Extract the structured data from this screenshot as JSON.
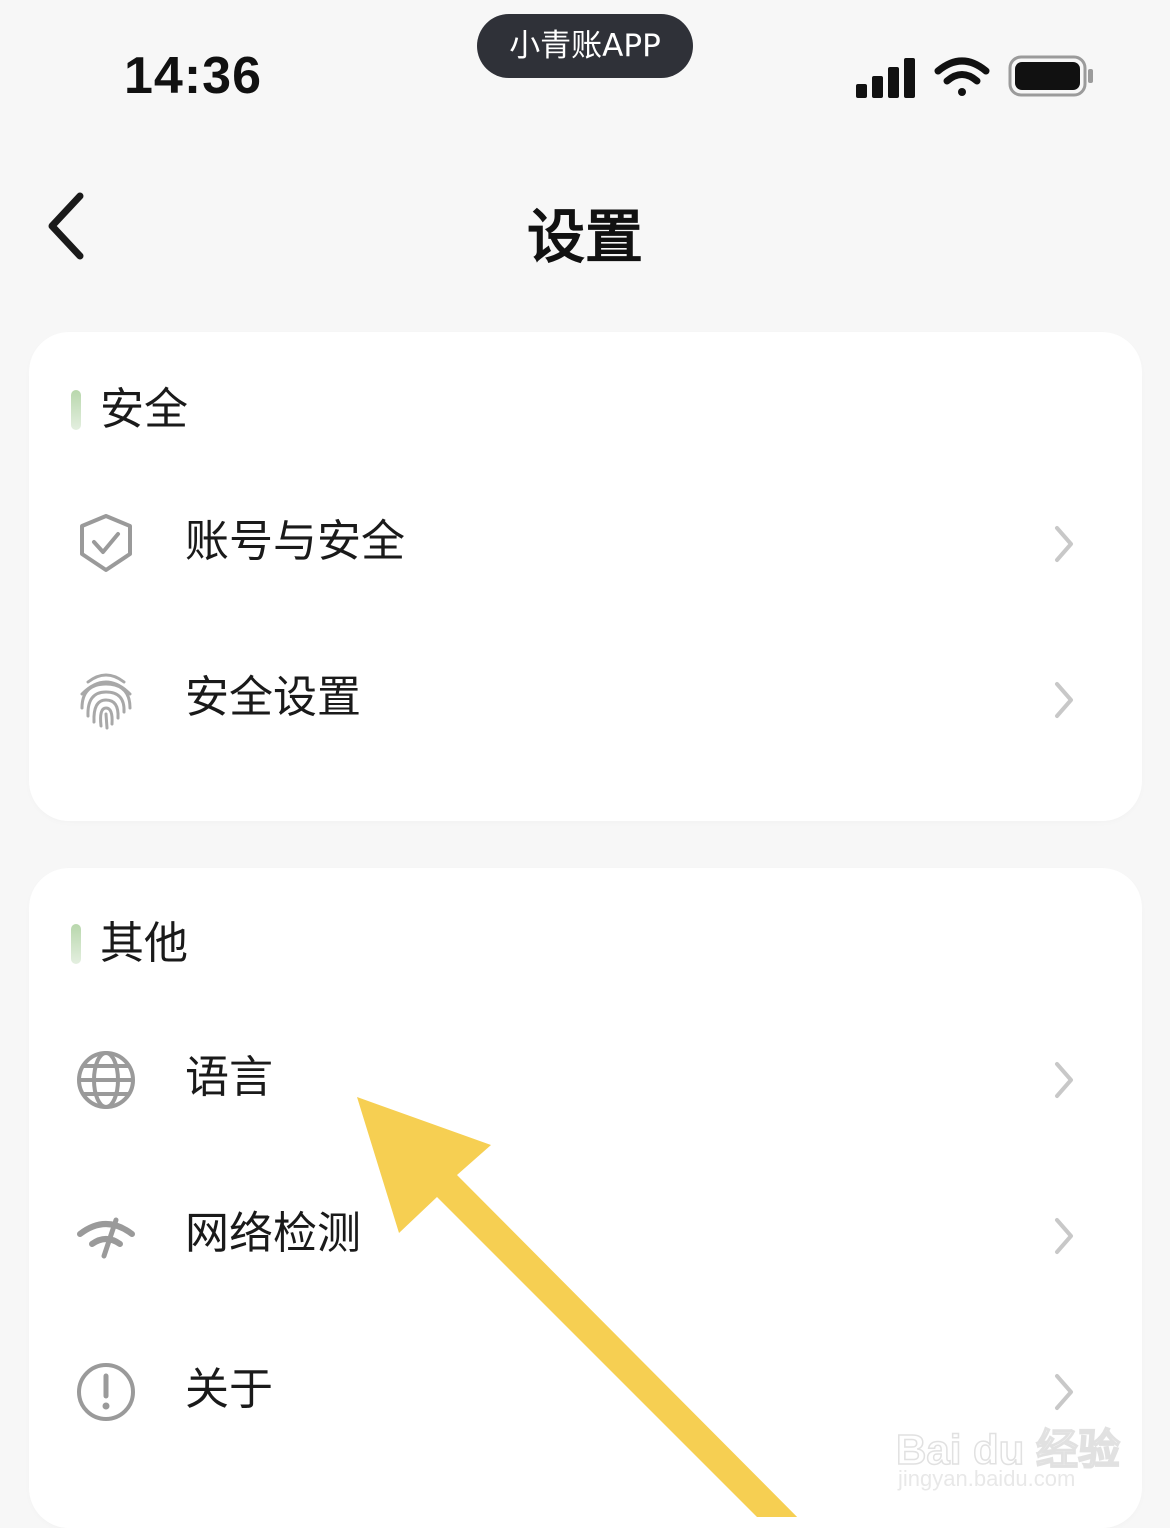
{
  "status_bar": {
    "time": "14:36",
    "app_name": "小青账APP",
    "icons": [
      "signal-icon",
      "wifi-icon",
      "battery-icon"
    ]
  },
  "nav": {
    "title": "设置",
    "back_icon": "back-chevron-icon"
  },
  "sections": [
    {
      "title": "安全",
      "items": [
        {
          "label": "账号与安全",
          "icon": "shield-check-icon"
        },
        {
          "label": "安全设置",
          "icon": "fingerprint-icon"
        }
      ]
    },
    {
      "title": "其他",
      "items": [
        {
          "label": "语言",
          "icon": "globe-icon"
        },
        {
          "label": "网络检测",
          "icon": "network-speed-icon"
        },
        {
          "label": "关于",
          "icon": "info-exclamation-icon"
        }
      ]
    }
  ],
  "colors": {
    "background": "#f7f7f7",
    "card": "#ffffff",
    "section_accent": "#b8d7ac",
    "icon_gray": "#9a9a9a",
    "chevron_gray": "#c8c8c8",
    "pill": "#2f3138",
    "annotation_arrow": "#f6cf52"
  },
  "watermark": {
    "brand": "Bai du 经验",
    "domain": "jingyan.baidu.com"
  }
}
